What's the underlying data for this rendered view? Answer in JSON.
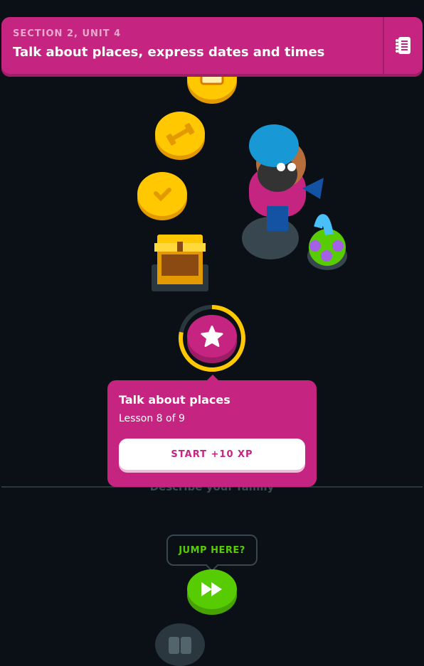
{
  "header": {
    "section": "SECTION 2, UNIT 4",
    "title": "Talk about places, express dates and times",
    "guide_icon": "notebook-icon"
  },
  "path": {
    "nodes": [
      {
        "type": "completed",
        "icon": "book-icon"
      },
      {
        "type": "completed",
        "icon": "dumbbell-icon"
      },
      {
        "type": "completed",
        "icon": "check-icon"
      },
      {
        "type": "chest",
        "icon": "treasure-chest-icon"
      },
      {
        "type": "current",
        "icon": "star-icon",
        "progress": 0.78
      }
    ],
    "next_unit_label": "Describe your family"
  },
  "popup": {
    "title": "Talk about places",
    "subtitle": "Lesson 8 of 9",
    "start_label": "START +10 XP"
  },
  "jump": {
    "label": "JUMP HERE?",
    "icon": "fast-forward-icon"
  },
  "colors": {
    "accent": "#c52580",
    "gold": "#ffc800",
    "green": "#58cc02",
    "background": "#0a1016"
  }
}
